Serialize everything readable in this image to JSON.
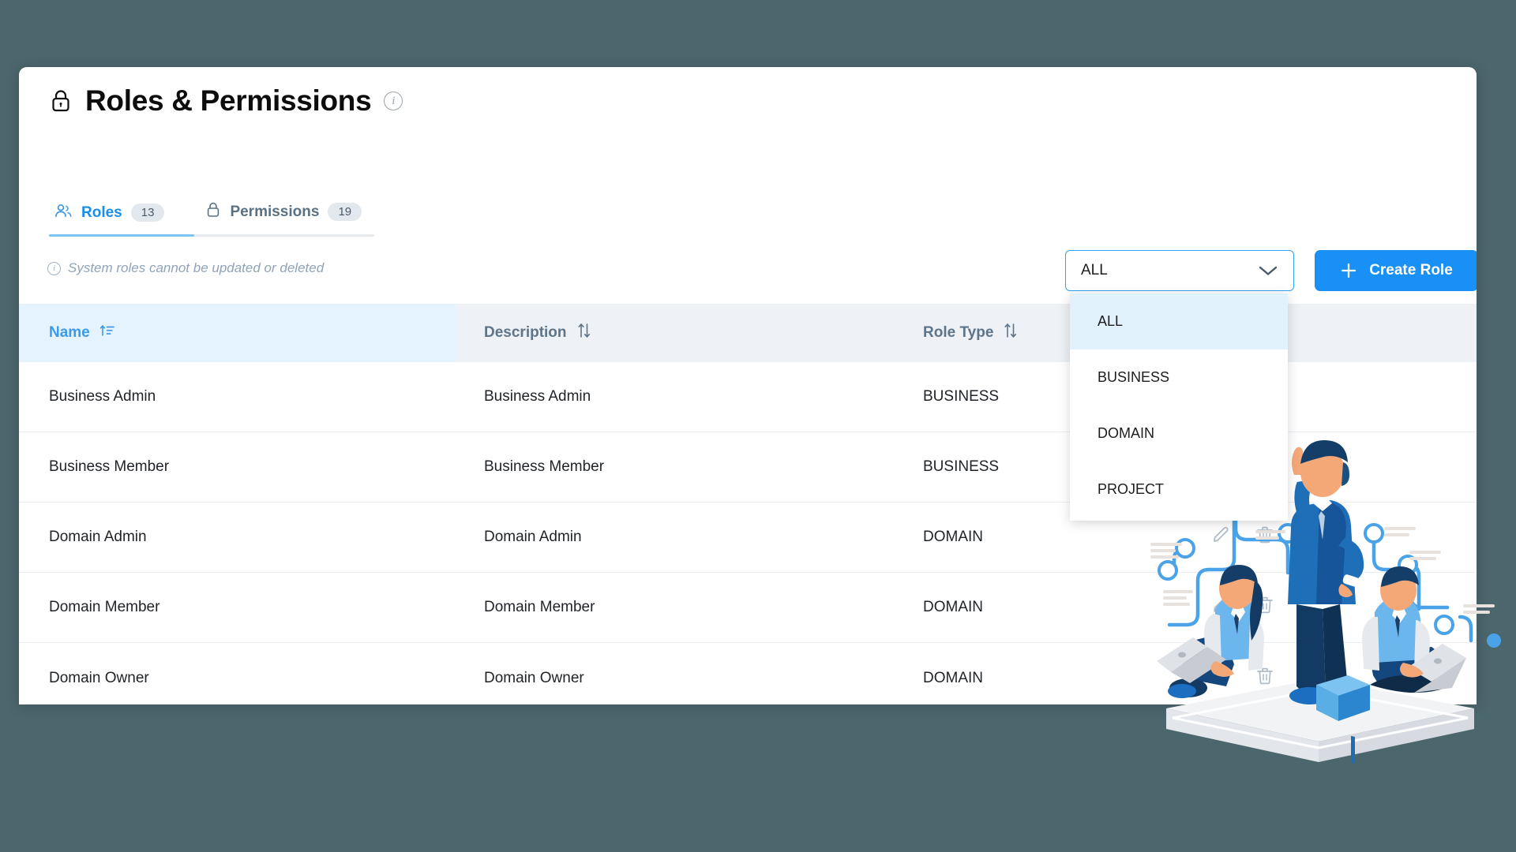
{
  "theme": {
    "page_background": "#4c666d",
    "card_background": "#ffffff",
    "accent_blue": "#1890f5",
    "tab_active_blue": "#1a8fe8",
    "header_row_gray": "#eef1f5",
    "name_col_highlight": "#e4f3fd",
    "muted_text": "#5d7489"
  },
  "header": {
    "title": "Roles & Permissions",
    "lock_icon": "lock-icon",
    "info_icon": "info-icon"
  },
  "tabs": [
    {
      "label": "Roles",
      "badge": "13",
      "icon": "people-icon",
      "active": true
    },
    {
      "label": "Permissions",
      "badge": "19",
      "icon": "lock-icon",
      "active": false
    }
  ],
  "notice": {
    "icon": "info-icon",
    "text": "System roles cannot be updated or deleted"
  },
  "filter": {
    "selected": "ALL",
    "chevron_icon": "chevron-down-icon",
    "open": true,
    "options": [
      "ALL",
      "BUSINESS",
      "DOMAIN",
      "PROJECT"
    ]
  },
  "create_button": {
    "label": "Create Role",
    "icon": "plus-icon"
  },
  "table": {
    "columns": [
      {
        "label": "Name",
        "sort_icon": "sort-ascending-icon",
        "sorted": true
      },
      {
        "label": "Description",
        "sort_icon": "sort-updown-icon",
        "sorted": false
      },
      {
        "label": "Role Type",
        "sort_icon": "sort-updown-icon",
        "sorted": false
      },
      {
        "label": "",
        "sort_icon": "",
        "sorted": false
      }
    ],
    "row_actions": [
      {
        "icon": "pencil-icon",
        "name": "edit-role-button"
      },
      {
        "icon": "trash-icon",
        "name": "delete-role-button"
      }
    ],
    "rows": [
      {
        "name": "Business Admin",
        "description": "Business Admin",
        "role_type": "BUSINESS"
      },
      {
        "name": "Business Member",
        "description": "Business Member",
        "role_type": "BUSINESS"
      },
      {
        "name": "Domain Admin",
        "description": "Domain Admin",
        "role_type": "DOMAIN"
      },
      {
        "name": "Domain Member",
        "description": "Domain Member",
        "role_type": "DOMAIN"
      },
      {
        "name": "Domain Owner",
        "description": "Domain Owner",
        "role_type": "DOMAIN"
      }
    ]
  },
  "illustration": {
    "name": "team-collaboration-illustration",
    "description": "Three business people on a platform, one standing pointing up, two sitting with laptops, blue flowchart lines behind"
  }
}
